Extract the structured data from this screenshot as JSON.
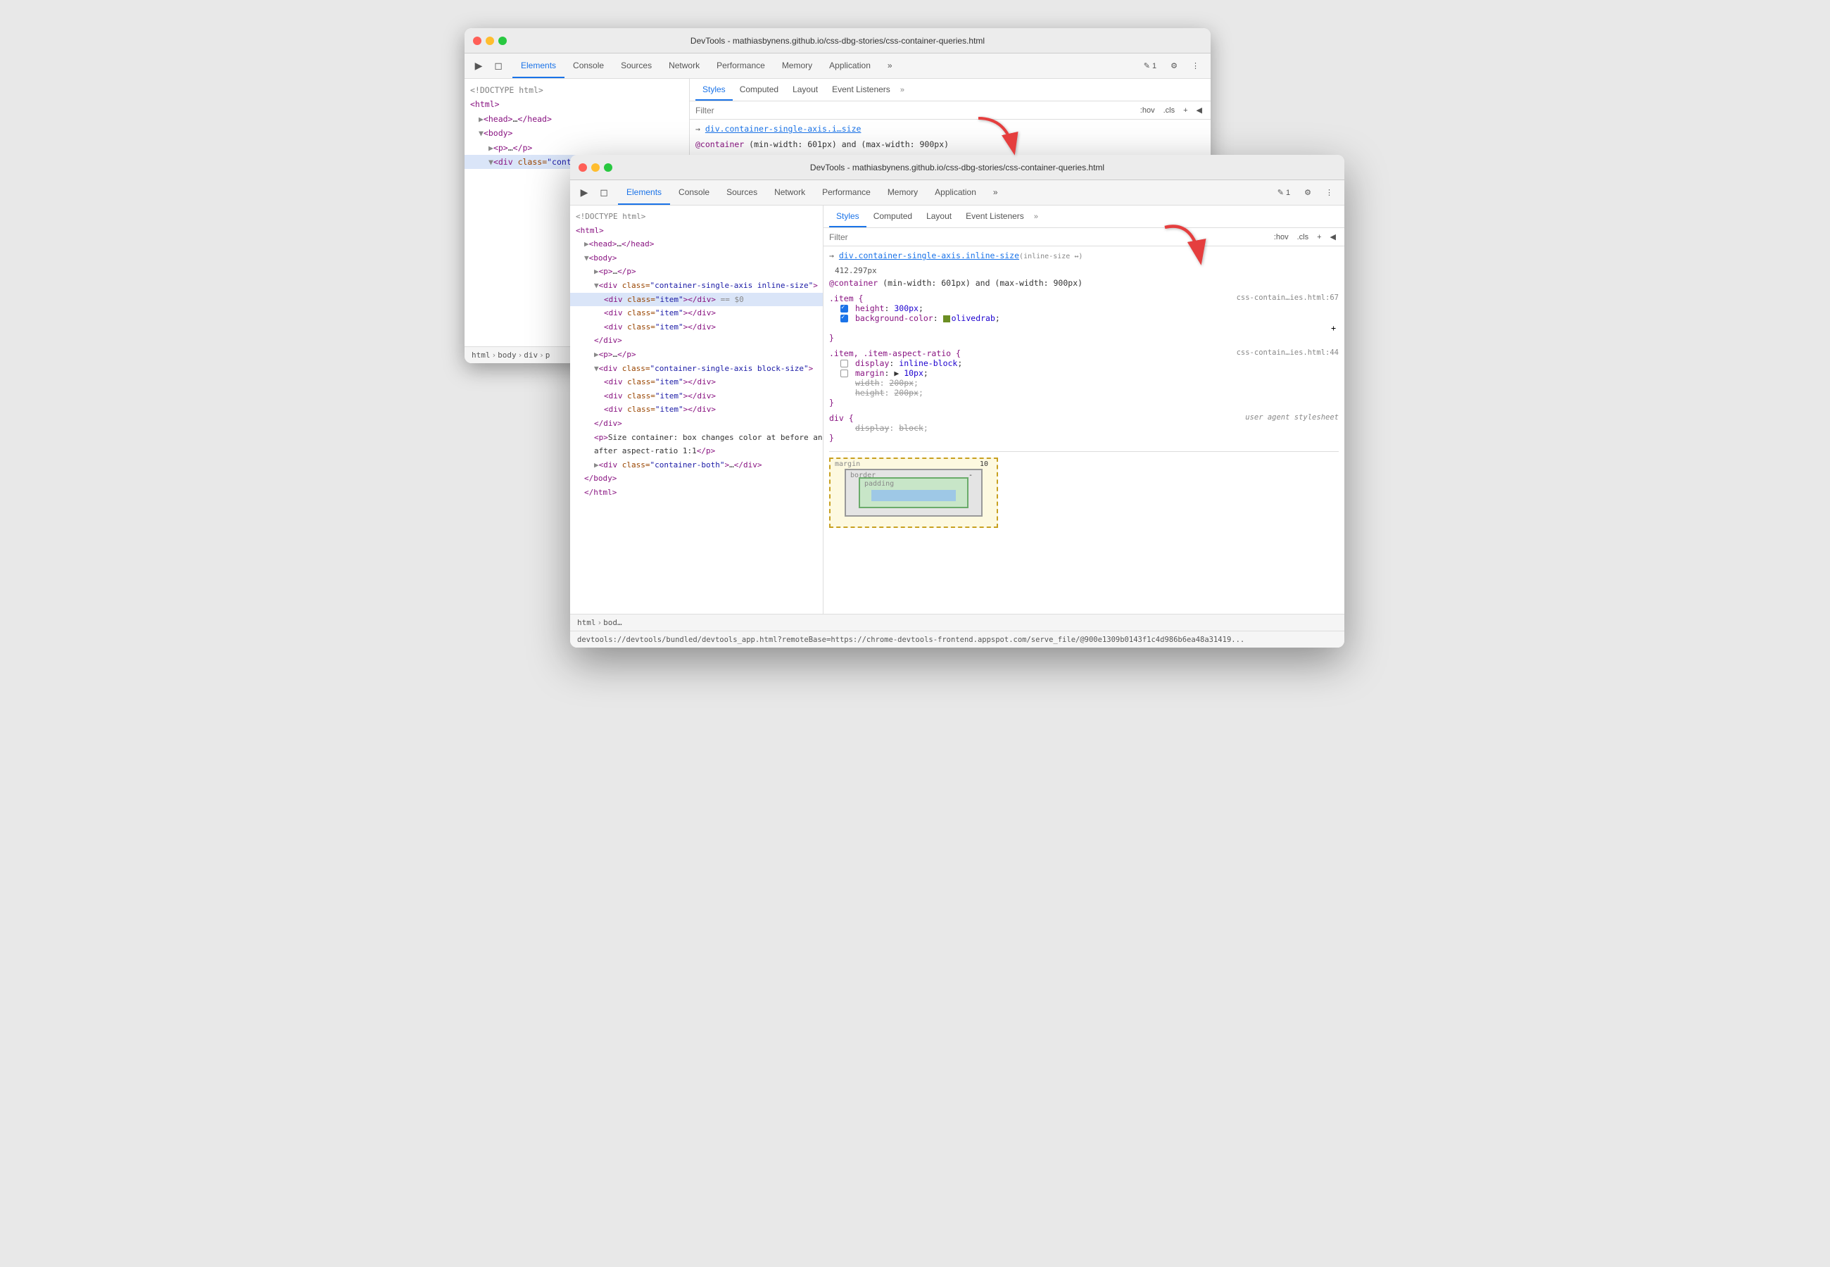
{
  "windows": {
    "back": {
      "title": "DevTools - mathiasbynens.github.io/css-dbg-stories/css-container-queries.html",
      "tabs": [
        "Elements",
        "Console",
        "Sources",
        "Network",
        "Performance",
        "Memory",
        "Application",
        "»"
      ],
      "active_tab": "Elements",
      "sub_tabs": [
        "Styles",
        "Computed",
        "Layout",
        "Event Listeners",
        "»"
      ],
      "active_sub_tab": "Styles",
      "filter_placeholder": "Filter",
      "filter_buttons": [
        ":hov",
        ".cls",
        "+",
        "◀"
      ],
      "dom_content": [
        {
          "indent": 0,
          "text": "<!DOCTYPE html>"
        },
        {
          "indent": 0,
          "text": "<html>"
        },
        {
          "indent": 1,
          "text": "▶<head>…</head>"
        },
        {
          "indent": 1,
          "text": "▼<body>"
        },
        {
          "indent": 2,
          "text": "▶<p>…</p>"
        },
        {
          "indent": 2,
          "text": "▼<div class=\"container-single-axis inline-size\">"
        }
      ],
      "css_rules": [
        {
          "selector": "→ div.container-single-axis.i…size",
          "link": true,
          "source": "",
          "props": []
        },
        {
          "at_rule": "@container (min-width: 601px) and (max-width: 900px)",
          "props": []
        },
        {
          "selector": ".item {",
          "source": "css-contain…ies.html:67",
          "props": []
        }
      ]
    },
    "front": {
      "title": "DevTools - mathiasbynens.github.io/css-dbg-stories/css-container-queries.html",
      "tabs": [
        "Elements",
        "Console",
        "Sources",
        "Network",
        "Performance",
        "Memory",
        "Application",
        "»"
      ],
      "active_tab": "Elements",
      "sub_tabs": [
        "Styles",
        "Computed",
        "Layout",
        "Event Listeners",
        "»"
      ],
      "active_sub_tab": "Styles",
      "filter_placeholder": "Filter",
      "filter_buttons": [
        ":hov",
        ".cls",
        "+",
        "◀"
      ],
      "dom_lines": [
        {
          "indent": 0,
          "text": "<!DOCTYPE html>",
          "type": "comment"
        },
        {
          "indent": 0,
          "html": "<span class='dom-tag'>&lt;html&gt;</span>"
        },
        {
          "indent": 1,
          "html": "<span class='dom-expand'>▶</span><span class='dom-tag'>&lt;head&gt;</span><span class='dom-text'>…</span><span class='dom-tag'>&lt;/head&gt;</span>"
        },
        {
          "indent": 1,
          "html": "<span class='dom-expand'>▼</span><span class='dom-tag'>&lt;body&gt;</span>"
        },
        {
          "indent": 2,
          "html": "<span class='dom-expand'>▶</span><span class='dom-tag'>&lt;p&gt;</span><span class='dom-text'>…</span><span class='dom-tag'>&lt;/p&gt;</span>"
        },
        {
          "indent": 2,
          "html": "<span class='dom-expand'>▼</span><span class='dom-tag'>&lt;div</span> <span class='dom-attr-name'>class=</span><span class='dom-attr-value'>\"container-single-axis inline-size\"</span><span class='dom-tag'>&gt;</span>"
        },
        {
          "indent": 3,
          "html": "<span class='dom-expand'>▶</span><span class='dom-tag'>&lt;d…</span>"
        },
        {
          "indent": 3,
          "html": "<span class='dom-expand'>▶</span><span class='dom-tag'>&lt;d…</span>"
        },
        {
          "indent": 3,
          "html": "<span class='dom-expand'>▶</span><span class='dom-tag'>&lt;d…</span>"
        },
        {
          "indent": 2,
          "html": "<span class='dom-tag'>&lt;/di…</span>"
        },
        {
          "indent": 2,
          "html": "<span class='dom-expand'>▶</span><span class='dom-tag'>&lt;S…</span>"
        },
        {
          "indent": 2,
          "html": "<span class='dom-expand'>▶</span><span class='dom-tag'>afte…</span>"
        },
        {
          "indent": 2,
          "html": "<span class='dom-expand'>▶</span><span class='dom-tag'>&lt;div…</span>"
        },
        {
          "indent": 1,
          "html": "<span class='dom-tag'>&lt;/body&gt;</span>"
        },
        {
          "indent": 1,
          "html": "<span class='dom-tag'>&lt;/html&gt;</span>"
        }
      ],
      "dom_selected_index": 5,
      "dom_expanded": [
        {
          "indent": 2,
          "html": "<span class='dom-expand'>▼</span><span class='dom-tag'>&lt;div</span> <span class='dom-attr-name'>class=</span><span class='dom-attr-value'>\"container-single-axis inline-size\"</span><span class='dom-tag'>&gt;</span>"
        },
        {
          "indent": 3,
          "html": "<span class='dom-tag'>&lt;div</span> <span class='dom-attr-name'>class=</span><span class='dom-attr-value'>\"item\"</span><span class='dom-tag'>&gt;&lt;/div&gt;</span> <span style='color:#888'>== $0</span>",
          "selected": true
        },
        {
          "indent": 3,
          "html": "<span class='dom-tag'>&lt;div</span> <span class='dom-attr-name'>class=</span><span class='dom-attr-value'>\"item\"</span><span class='dom-tag'>&gt;&lt;/div&gt;</span>"
        },
        {
          "indent": 3,
          "html": "<span class='dom-tag'>&lt;div</span> <span class='dom-attr-name'>class=</span><span class='dom-attr-value'>\"item\"</span><span class='dom-tag'>&gt;&lt;/div&gt;</span>"
        },
        {
          "indent": 2,
          "html": "<span class='dom-tag'>&lt;/div&gt;</span>"
        },
        {
          "indent": 2,
          "html": "<span class='dom-expand'>▶</span><span class='dom-tag'>&lt;p&gt;</span><span class='dom-text'>…</span><span class='dom-tag'>&lt;/p&gt;</span>"
        },
        {
          "indent": 2,
          "html": "<span class='dom-expand'>▼</span><span class='dom-tag'>&lt;div</span> <span class='dom-attr-name'>class=</span><span class='dom-attr-value'>\"container-single-axis block-size\"</span><span class='dom-tag'>&gt;</span>"
        },
        {
          "indent": 3,
          "html": "<span class='dom-tag'>&lt;div</span> <span class='dom-attr-name'>class=</span><span class='dom-attr-value'>\"item\"</span><span class='dom-tag'>&gt;&lt;/div&gt;</span>"
        },
        {
          "indent": 3,
          "html": "<span class='dom-tag'>&lt;div</span> <span class='dom-attr-name'>class=</span><span class='dom-attr-value'>\"item\"</span><span class='dom-tag'>&gt;&lt;/div&gt;</span>"
        },
        {
          "indent": 3,
          "html": "<span class='dom-tag'>&lt;div</span> <span class='dom-attr-name'>class=</span><span class='dom-attr-value'>\"item\"</span><span class='dom-tag'>&gt;&lt;/div&gt;</span>"
        },
        {
          "indent": 2,
          "html": "<span class='dom-tag'>&lt;/div&gt;</span>"
        },
        {
          "indent": 2,
          "html": "<span class='dom-tag'>&lt;p&gt;</span><span class='dom-text'>Size container: box changes color at before and</span>"
        },
        {
          "indent": 2,
          "html": "<span class='dom-text'>after aspect-ratio 1:1</span><span class='dom-tag'>&lt;/p&gt;</span>"
        },
        {
          "indent": 2,
          "html": "<span class='dom-expand'>▶</span><span class='dom-tag'>&lt;div</span> <span class='dom-attr-name'>class=</span><span class='dom-attr-value'>\"container-both\"</span><span class='dom-tag'>&gt;</span><span class='dom-text'>…</span><span class='dom-tag'>&lt;/div&gt;</span>"
        },
        {
          "indent": 1,
          "html": "<span class='dom-tag'>&lt;/body&gt;</span>"
        },
        {
          "indent": 1,
          "html": "<span class='dom-tag'>&lt;/html&gt;</span>"
        }
      ],
      "css_rules_front": [
        {
          "id": "selector1",
          "selector_html": "<span>→ </span><a href='#' style='color:#1a73e8;text-decoration:underline'>div.container-single-axis.inline-size</a><span style='color:#555'>(inline-size ↔)</span>",
          "source": "",
          "size_value": "412.297px",
          "props": []
        },
        {
          "id": "container_query",
          "html": "@container (min-width: 601px) and (max-width: 900px)",
          "type": "at-rule"
        },
        {
          "id": "item_rule",
          "selector": ".item {",
          "source": "css-contain…ies.html:67",
          "props": [
            {
              "checked": true,
              "name": "height",
              "value": "300px"
            },
            {
              "checked": true,
              "name": "background-color",
              "value": "olivedrab",
              "color": "olivedrab"
            }
          ],
          "close": "}"
        },
        {
          "id": "item_rule2",
          "selector": ".item, .item-aspect-ratio {",
          "source": "css-contain…ies.html:44",
          "props": [
            {
              "checked": false,
              "name": "display",
              "value": "inline-block"
            },
            {
              "checked": false,
              "name": "margin",
              "value": "▶ 10px"
            },
            {
              "strikethrough": true,
              "name": "width",
              "value": "200px"
            },
            {
              "strikethrough": true,
              "name": "height",
              "value": "200px"
            }
          ],
          "close": "}"
        },
        {
          "id": "div_rule",
          "selector": "div {",
          "source_italic": "user agent stylesheet",
          "props": [
            {
              "strikethrough": true,
              "name": "display",
              "value": "block"
            }
          ],
          "close": "}"
        }
      ],
      "box_model": {
        "margin_label": "margin",
        "margin_value": "10",
        "border_label": "border",
        "border_value": "-",
        "padding_label": "padding"
      }
    }
  },
  "status_bar": {
    "text": "devtools://devtools/bundled/devtools_app.html?remoteBase=https://chrome-devtools-frontend.appspot.com/serve_file/@900e1309b0143f1c4d986b6ea48a31419..."
  },
  "breadcrumb_back": {
    "items": [
      "html",
      "body",
      "div",
      "p"
    ]
  },
  "breadcrumb_front": {
    "items": [
      "html",
      "bod…"
    ]
  }
}
